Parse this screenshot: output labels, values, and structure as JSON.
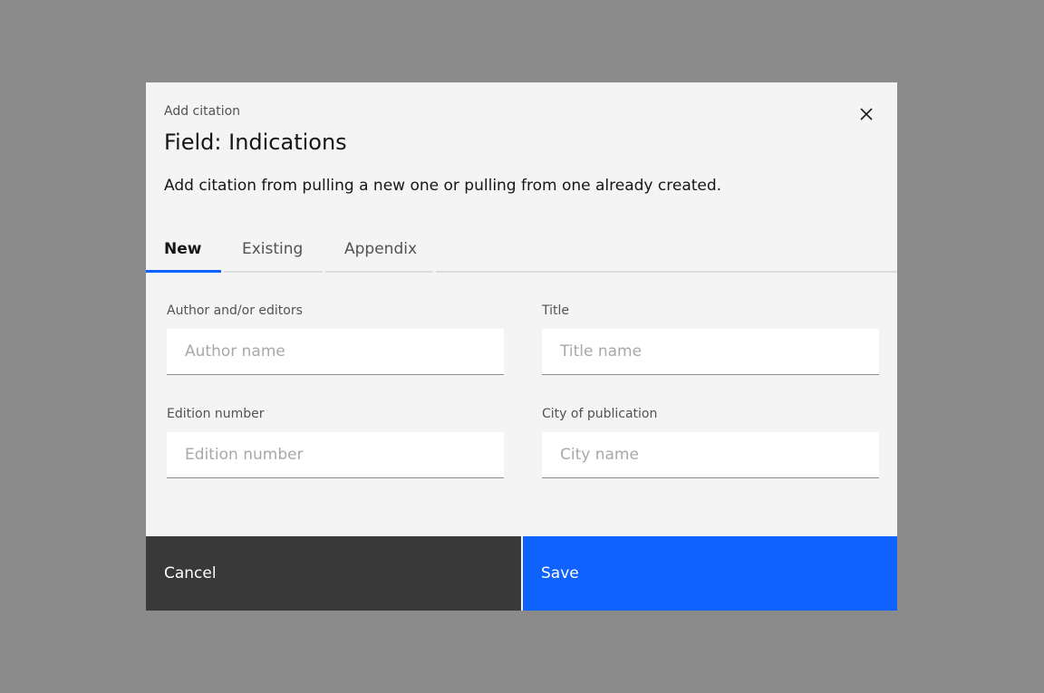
{
  "modal": {
    "label": "Add citation",
    "title": "Field: Indications",
    "description": "Add citation from pulling a new one or pulling from one already created.",
    "tabs": [
      {
        "label": "New",
        "active": true
      },
      {
        "label": "Existing"
      },
      {
        "label": "Appendix"
      }
    ],
    "fields": {
      "author": {
        "label": "Author and/or editors",
        "placeholder": "Author name"
      },
      "title": {
        "label": "Title",
        "placeholder": "Title name"
      },
      "edition": {
        "label": "Edition number",
        "placeholder": "Edition number"
      },
      "city": {
        "label": "City of publication",
        "placeholder": "City name"
      }
    },
    "cancel": "Cancel",
    "save": "Save"
  },
  "colors": {
    "primary": "#0f62fe",
    "secondary": "#393939"
  }
}
